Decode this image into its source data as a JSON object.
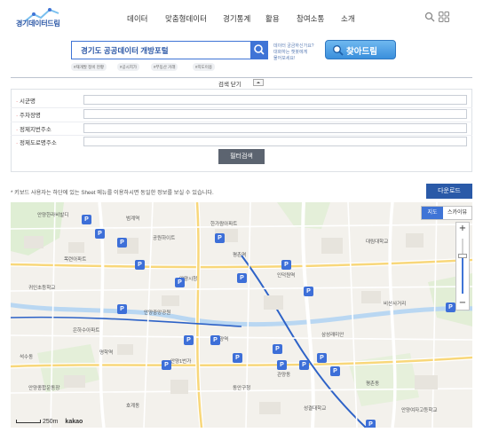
{
  "header": {
    "logo_text": "경기데이터드림",
    "nav": [
      "데이터",
      "맞춤형데이터",
      "경기통계",
      "활용",
      "참여소통",
      "소개"
    ],
    "icons": [
      "search-icon",
      "grid-menu-icon"
    ]
  },
  "search": {
    "placeholder": "경기도 공공데이터 개방포털",
    "side_text_line1": "데이터 궁금하신가요?",
    "side_text_line2": "대화하는 챗봇에게",
    "side_text_line3": "물어보세요!",
    "find_label": "찾아드림",
    "tags": [
      "#재개발 정비 현황",
      "#공시지가",
      "#부동산 거래",
      "#지도이용"
    ]
  },
  "filter": {
    "toggle_label": "검색 닫기",
    "fields": [
      {
        "label": "시군명",
        "value": ""
      },
      {
        "label": "주차장명",
        "value": ""
      },
      {
        "label": "정제지번주소",
        "value": ""
      },
      {
        "label": "정제도로명주소",
        "value": ""
      }
    ],
    "search_button": "필터검색"
  },
  "notice": "* 키보드 사용자는 하단에 있는 Sheet 메뉴를 이용하시면 동일한 정보를 보실 수 있습니다.",
  "download_button": "다운로드",
  "map": {
    "type_road": "지도",
    "type_sky": "스카이뷰",
    "zoom_in": "+",
    "zoom_out": "−",
    "scale_label": "250m",
    "provider": "kakao",
    "place_labels": [
      "안양한라비발디",
      "범계역",
      "공원하이트",
      "한가람아파트",
      "목련아파트",
      "평촌역",
      "안양시청",
      "귀인초등학교",
      "인덕원역",
      "대림대학교",
      "안양중앙공원",
      "비산사거리",
      "은하수아파트",
      "삼성래미안",
      "안양역",
      "명학역",
      "안양1번가",
      "관양동",
      "동안구청",
      "평촌동",
      "안양종합운동장",
      "호계동",
      "성결대학교",
      "안양여자고등학교",
      "석수동"
    ],
    "marker_label": "P"
  },
  "colors": {
    "accent": "#3f74d6",
    "download": "#2a5aa8",
    "filter_button": "#5c6470"
  }
}
